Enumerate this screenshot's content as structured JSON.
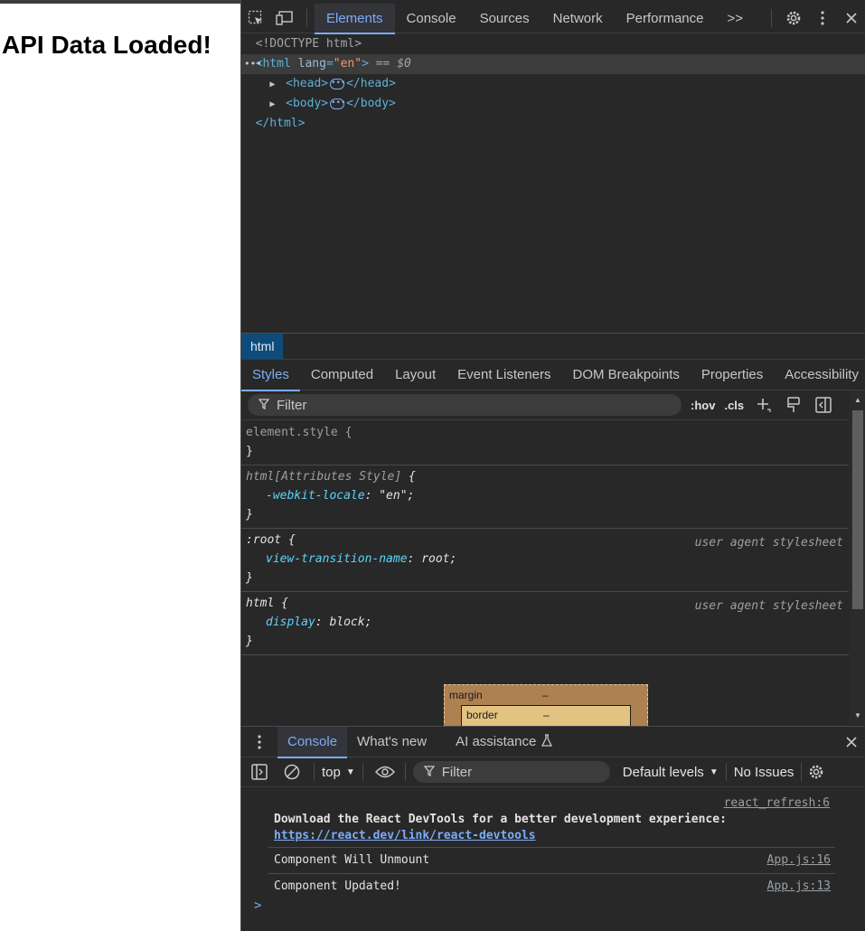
{
  "page": {
    "heading": "API Data Loaded!"
  },
  "toolbar": {
    "tabs": [
      "Elements",
      "Console",
      "Sources",
      "Network",
      "Performance"
    ],
    "active_tab": "Elements",
    "more_tabs": ">>"
  },
  "dom": {
    "doctype": "<!DOCTYPE html>",
    "html_open_tag": "<html",
    "html_lang_attr": "lang",
    "html_lang_value": "\"en\"",
    "html_close_bracket": ">",
    "selected_marker": "== $0",
    "head_open": "<head>",
    "head_close": "</head>",
    "body_open": "<body>",
    "body_close": "</body>",
    "html_close": "</html>"
  },
  "breadcrumb": {
    "item": "html"
  },
  "sidebar": {
    "tabs": [
      "Styles",
      "Computed",
      "Layout",
      "Event Listeners",
      "DOM Breakpoints",
      "Properties",
      "Accessibility"
    ],
    "active_tab": "Styles"
  },
  "styles": {
    "filter_placeholder": "Filter",
    "hov": ":hov",
    "cls": ".cls",
    "rules": [
      {
        "selector": "element.style {",
        "close": "}"
      },
      {
        "selector": "html[Attributes Style]",
        "brace": " {",
        "prop": "-webkit-locale",
        "value": "\"en\";",
        "close": "}"
      },
      {
        "selector": ":root",
        "brace": " {",
        "prop": "view-transition-name",
        "value": "root;",
        "origin": "user agent stylesheet",
        "close": "}"
      },
      {
        "selector": "html",
        "brace": " {",
        "prop": "display",
        "value": "block;",
        "origin": "user agent stylesheet",
        "close": "}"
      }
    ],
    "box_model": {
      "margin_label": "margin",
      "margin_value": "–",
      "border_label": "border",
      "border_value": "–"
    }
  },
  "drawer": {
    "tabs": [
      "Console",
      "What's new",
      "AI assistance"
    ],
    "active_tab": "Console"
  },
  "console": {
    "context": "top",
    "filter_placeholder": "Filter",
    "levels": "Default levels",
    "issues": "No Issues",
    "messages": [
      {
        "source": "react_refresh:6",
        "text": "Download the React DevTools for a better development experience:",
        "link": "https://react.dev/link/react-devtools"
      },
      {
        "text": "Component Will Unmount",
        "source": "App.js:16"
      },
      {
        "text": "Component Updated!",
        "source": "App.js:13"
      }
    ],
    "prompt": ">"
  },
  "colors": {
    "accent": "#7cacf8",
    "panel_bg": "#282828",
    "tag": "#5db0d7",
    "attr_value": "#f29766",
    "selected_crumb": "#0e4b7a"
  },
  "icons": [
    "inspect-element-icon",
    "device-toolbar-icon",
    "settings-gear-icon",
    "kebab-menu-icon",
    "close-icon",
    "filter-icon",
    "add-rule-icon",
    "paint-brush-icon",
    "sidebar-toggle-icon",
    "flask-icon",
    "console-sidebar-icon",
    "clear-console-icon",
    "eye-icon",
    "chevron-down-icon"
  ]
}
